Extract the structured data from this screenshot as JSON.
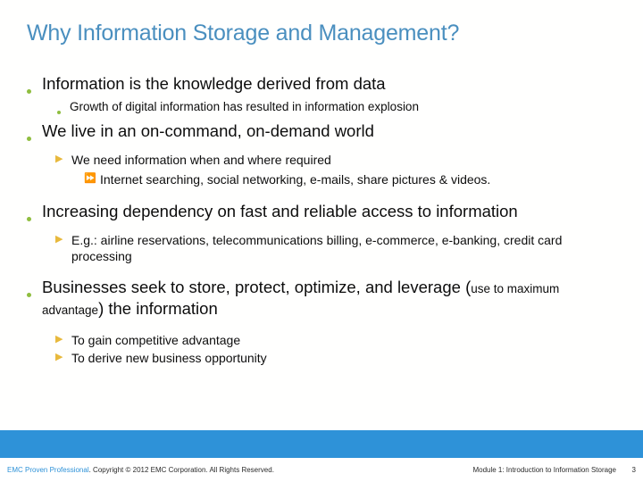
{
  "slide": {
    "title": "Why Information Storage and Management?",
    "title_color": "#4a8fbf",
    "background_color": "#ffffff",
    "accent_bar_color": "#2e92d8",
    "bullet_dot_color": "#8fbe3f",
    "bullet_arrow_color": "#e8b93c"
  },
  "content": {
    "b1": {
      "marker": "bullet-dot",
      "text": "Information is the knowledge derived from data"
    },
    "b1s1": {
      "marker": "bullet-dot",
      "text": "Growth of digital information has resulted in information explosion"
    },
    "b2": {
      "marker": "bullet-dot",
      "text": "We live in an on-command, on-demand world"
    },
    "b2s1": {
      "marker": "arrow-single",
      "text": "We need information when and where required"
    },
    "b2s1s1": {
      "marker": "arrow-double",
      "text": "Internet searching, social networking, e-mails, share pictures & videos."
    },
    "b3": {
      "marker": "bullet-dot",
      "text": "Increasing dependency on fast and reliable access to information"
    },
    "b3s1": {
      "marker": "arrow-single",
      "text": "E.g.: airline reservations, telecommunications billing, e-commerce, e-banking, credit card processing"
    },
    "b4": {
      "marker": "bullet-dot",
      "text_part1": "Businesses seek to store, protect, optimize, and leverage ",
      "text_paren_open": "(",
      "text_small": "use to maximum advantage",
      "text_paren_close": ")",
      "text_part2": " the information"
    },
    "b4s1": {
      "marker": "arrow-single",
      "text": "To gain competitive advantage"
    },
    "b4s2": {
      "marker": "arrow-single",
      "text": "To derive new business opportunity"
    }
  },
  "footer": {
    "brand": "EMC Proven Professional",
    "copyright": ". Copyright © 2012 EMC Corporation. All Rights Reserved.",
    "module": "Module 1: Introduction to Information Storage",
    "page_number": "3"
  },
  "markers": {
    "dot": "•",
    "arrow_single": "▶",
    "arrow_double": "⏩"
  }
}
